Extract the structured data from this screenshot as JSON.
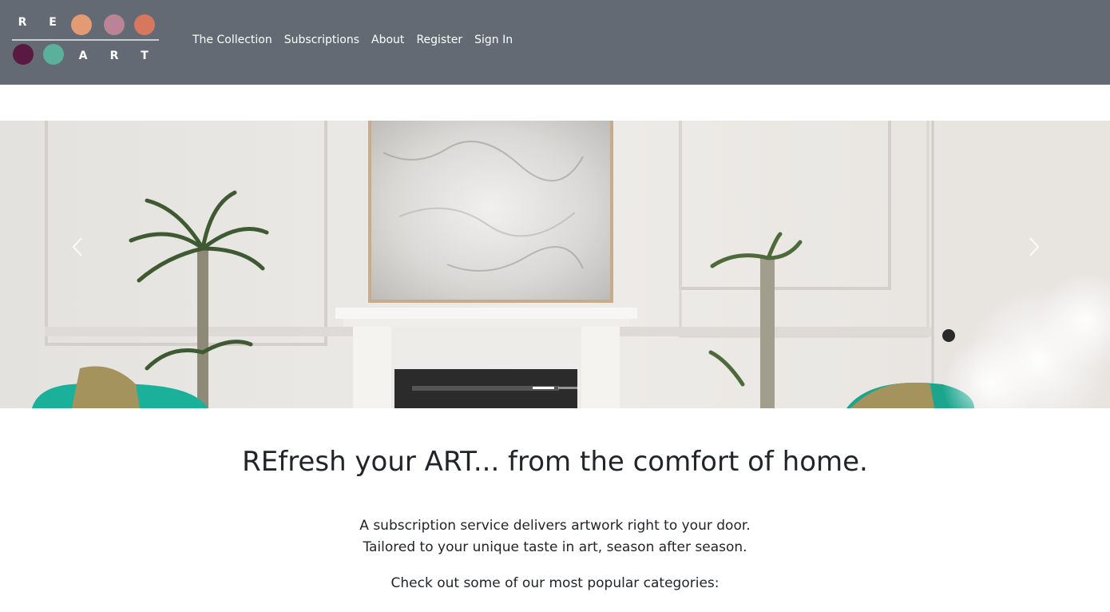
{
  "brand": {
    "logo_letters": [
      "R",
      "E",
      "A",
      "R",
      "T"
    ],
    "logo_colors": {
      "peach": "#e39b73",
      "mauve": "#bb8495",
      "coral": "#d7775e",
      "plum": "#5a1941",
      "teal": "#5bb09b"
    }
  },
  "nav": {
    "items": [
      {
        "label": "The Collection"
      },
      {
        "label": "Subscriptions"
      },
      {
        "label": "About"
      },
      {
        "label": "Register"
      },
      {
        "label": "Sign In"
      }
    ]
  },
  "carousel": {
    "slide_count": 2,
    "active_index": 0,
    "prev_icon": "chevron-left-icon",
    "next_icon": "chevron-right-icon"
  },
  "content": {
    "headline": "REfresh your ART... from the comfort of home.",
    "lead_line1": "A subscription service delivers artwork right to your door.",
    "lead_line2": "Tailored to your unique taste in art, season after season.",
    "categories_intro": "Check out some of our most popular categories:"
  },
  "colors": {
    "header_bg": "#636a73",
    "nav_text": "#ffffff",
    "body_text": "#212529"
  }
}
